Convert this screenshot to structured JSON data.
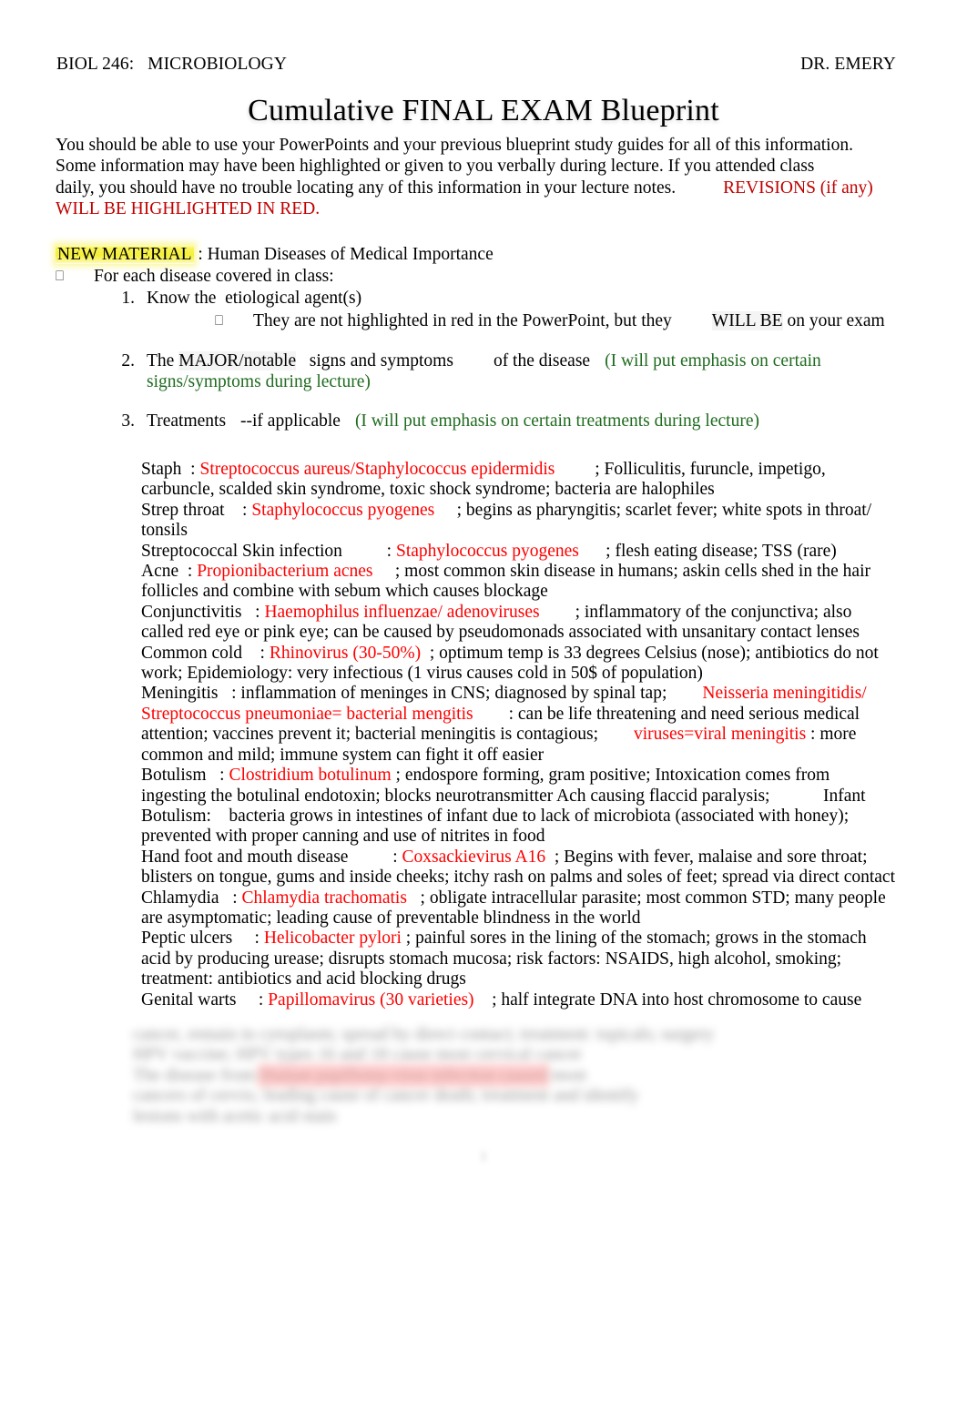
{
  "header": {
    "course": "BIOL 246:   MICROBIOLOGY",
    "instructor": "DR. EMERY"
  },
  "title": "Cumulative FINAL EXAM Blueprint",
  "colors": {
    "red": "#fe0000",
    "red_dark": "#c00000",
    "green": "#1f6b1f",
    "highlight_yellow": "#f5ef3a",
    "highlight_pink": "#ffadad"
  },
  "intro": {
    "line1": "You should be able to use your PowerPoints and your previous blueprint study guides for all of this information.",
    "line2": "Some information may have been highlighted or given to you verbally during lecture. If you attended class",
    "line3": "daily, you should have no trouble locating any of this information in your lecture notes.",
    "revisions_note": "REVISIONS (if any)",
    "line4_red": "WILL BE HIGHLIGHTED IN RED."
  },
  "new_material": {
    "label": "NEW MATERIAL",
    "label_suffix": " : Human Diseases of Medical Importance",
    "bullet_glyph": "⎕",
    "bullet_text": "For each disease covered in class:"
  },
  "numbered_items": [
    {
      "num": "1.",
      "text_a": "Know the  etiological agent(s)",
      "sub_glyph": "⎕",
      "sub_a": "They are not highlighted in red in the PowerPoint, but they",
      "sub_b": "WILL BE",
      "sub_c": " on your exam"
    },
    {
      "num": "2.",
      "text_a": "The ",
      "text_shaded": "MAJOR/notable",
      "text_b": "   signs and symptoms",
      "text_c": "of the disease",
      "green_a": "(I will put emphasis on certain",
      "green_b": "signs/symptoms during lecture)"
    },
    {
      "num": "3.",
      "text_a": "Treatments",
      "text_b": "--if applicable",
      "green_a": "(I will put emphasis on certain treatments during lecture)"
    }
  ],
  "diseases": [
    {
      "name": "Staph  : ",
      "agent": "Streptococcus aureus/Staphylococcus epidermidis",
      "gap": "         ",
      "desc": "; Folliculitis, furuncle, impetigo, carbuncle, scalded skin syndrome, toxic shock syndrome; bacteria are halophiles"
    },
    {
      "name": "Strep throat    : ",
      "agent": "Staphylococcus pyogenes",
      "gap": "     ",
      "desc": "; begins as pharyngitis; scarlet fever; white spots in throat/ tonsils"
    },
    {
      "name": "Streptococcal Skin infection          : ",
      "agent": "Staphylococcus pyogenes",
      "gap": "      ",
      "desc": "; flesh eating disease; TSS (rare)"
    },
    {
      "name": "Acne  : ",
      "agent": "Propionibacterium acnes",
      "gap": "     ",
      "desc": "; most common skin disease in humans; askin cells shed in the hair follicles and combine with sebum which causes blockage"
    },
    {
      "name": "Conjunctivitis   : ",
      "agent": "Haemophilus influenzae/ adenoviruses",
      "gap": "        ",
      "desc": "; inflammatory of the conjunctiva; also called red eye or pink eye; can be caused by pseudomonads associated with unsanitary contact lenses"
    },
    {
      "name": "Common cold    : ",
      "agent": "Rhinovirus (30-50%)",
      "gap": "  ",
      "desc": "; optimum temp is 33 degrees Celsius (nose); antibiotics do not work; Epidemiology: very infectious (1 virus causes cold in 50$ of population)"
    }
  ],
  "meningitis": {
    "lead": "Meningitis   : inflammation of meninges in CNS; diagnosed by spinal tap;",
    "gap1": "        ",
    "red1": "Neisseria meningitidis/ Streptococcus pneumoniae= bacterial mengitis",
    "gap2": "        ",
    "mid": ": can be life threatening and need serious medical attention; vaccines prevent it; bacterial meningitis is contagious;",
    "gap3": "        ",
    "red2": "viruses=viral meningitis",
    "tail": " : more common and mild; immune system can fight it off easier"
  },
  "botulism": {
    "name": "Botulism   : ",
    "agent": "Clostridium botulinum",
    "desc_a": " ; endospore forming, gram positive; Intoxication comes from ingesting the botulinal endotoxin; blocks neurotransmitter Ach causing flaccid paralysis;",
    "gap": "            ",
    "desc_b": "Infant Botulism:    bacteria grows in intestines of infant due to lack of microbiota (associated with honey); prevented with proper canning and use of nitrites in food"
  },
  "diseases2": [
    {
      "name": "Hand foot and mouth disease          : ",
      "agent": "Coxsackievirus A16",
      "gap": "  ",
      "desc": "; Begins with fever, malaise and sore throat; blisters on tongue, gums and inside cheeks; itchy rash on palms and soles of feet; spread via direct contact"
    },
    {
      "name": "Chlamydia   : ",
      "agent": "Chlamydia trachomatis",
      "gap": "   ",
      "desc": "; obligate intracellular parasite; most common STD; many people are asymptomatic; leading cause of preventable blindness in the world"
    },
    {
      "name": "Peptic ulcers     : ",
      "agent": "Helicobacter pylori",
      "gap": " ",
      "desc": "; painful sores in the lining of the stomach; grows in the stomach acid by producing urease; disrupts stomach mucosa; risk factors: NSAIDS, high alcohol, smoking; treatment: antibiotics and acid blocking drugs"
    },
    {
      "name": "Genital warts     : ",
      "agent": "Papillomavirus (30 varieties)",
      "gap": "    ",
      "desc": "; half integrate DNA into host chromosome to cause"
    }
  ],
  "redacted": {
    "note": "illegible blurred text",
    "line1": "cancer, remain in cytoplasm; spread by direct contact; treatment: topicals; surgery",
    "line2": "HPV vaccine; HPV types 16 and 18 cause most cervical cancer",
    "line3_a": "The disease from ",
    "line3_hl": "Human papilloma virus infection caused",
    "line3_b": " most",
    "line4": "cancers of cervix; leading cause of cancer death; treatment and identify",
    "line5": "lesions with acetic acid stain",
    "page_number": "1"
  }
}
